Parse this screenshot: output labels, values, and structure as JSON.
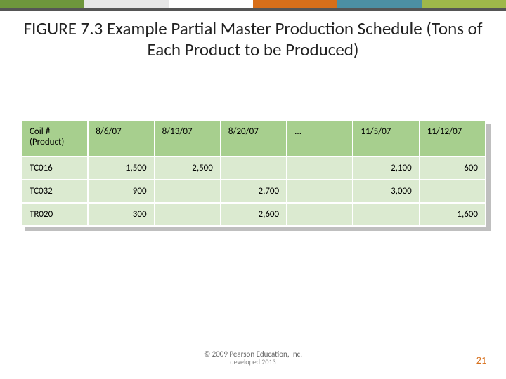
{
  "title": "FIGURE 7.3 Example Partial Master Production Schedule (Tons of Each Product to be Produced)",
  "chart_data": {
    "type": "table",
    "title": "Example Partial Master Production Schedule (Tons of Each Product to be Produced)",
    "columns": [
      "Coil # (Product)",
      "8/6/07",
      "8/13/07",
      "8/20/07",
      "...",
      "11/5/07",
      "11/12/07"
    ],
    "rows": [
      {
        "product": "TC016",
        "8/6/07": 1500,
        "8/13/07": 2500,
        "8/20/07": null,
        "...": null,
        "11/5/07": 2100,
        "11/12/07": 600
      },
      {
        "product": "TC032",
        "8/6/07": 900,
        "8/13/07": null,
        "8/20/07": 2700,
        "...": null,
        "11/5/07": 3000,
        "11/12/07": null
      },
      {
        "product": "TR020",
        "8/6/07": 300,
        "8/13/07": null,
        "8/20/07": 2600,
        "...": null,
        "11/5/07": null,
        "11/12/07": 1600
      }
    ]
  },
  "table": {
    "headers": [
      "Coil #\n(Product)",
      "8/6/07",
      "8/13/07",
      "8/20/07",
      "...",
      "11/5/07",
      "11/12/07"
    ],
    "rows": [
      [
        "TC016",
        "1,500",
        "2,500",
        "",
        "",
        "2,100",
        "600"
      ],
      [
        "TC032",
        "900",
        "",
        "2,700",
        "",
        "3,000",
        ""
      ],
      [
        "TR020",
        "300",
        "",
        "2,600",
        "",
        "",
        "1,600"
      ]
    ]
  },
  "footer1": "© 2009 Pearson Education, Inc.",
  "footer2": "developed 2013",
  "pagenum": "21"
}
